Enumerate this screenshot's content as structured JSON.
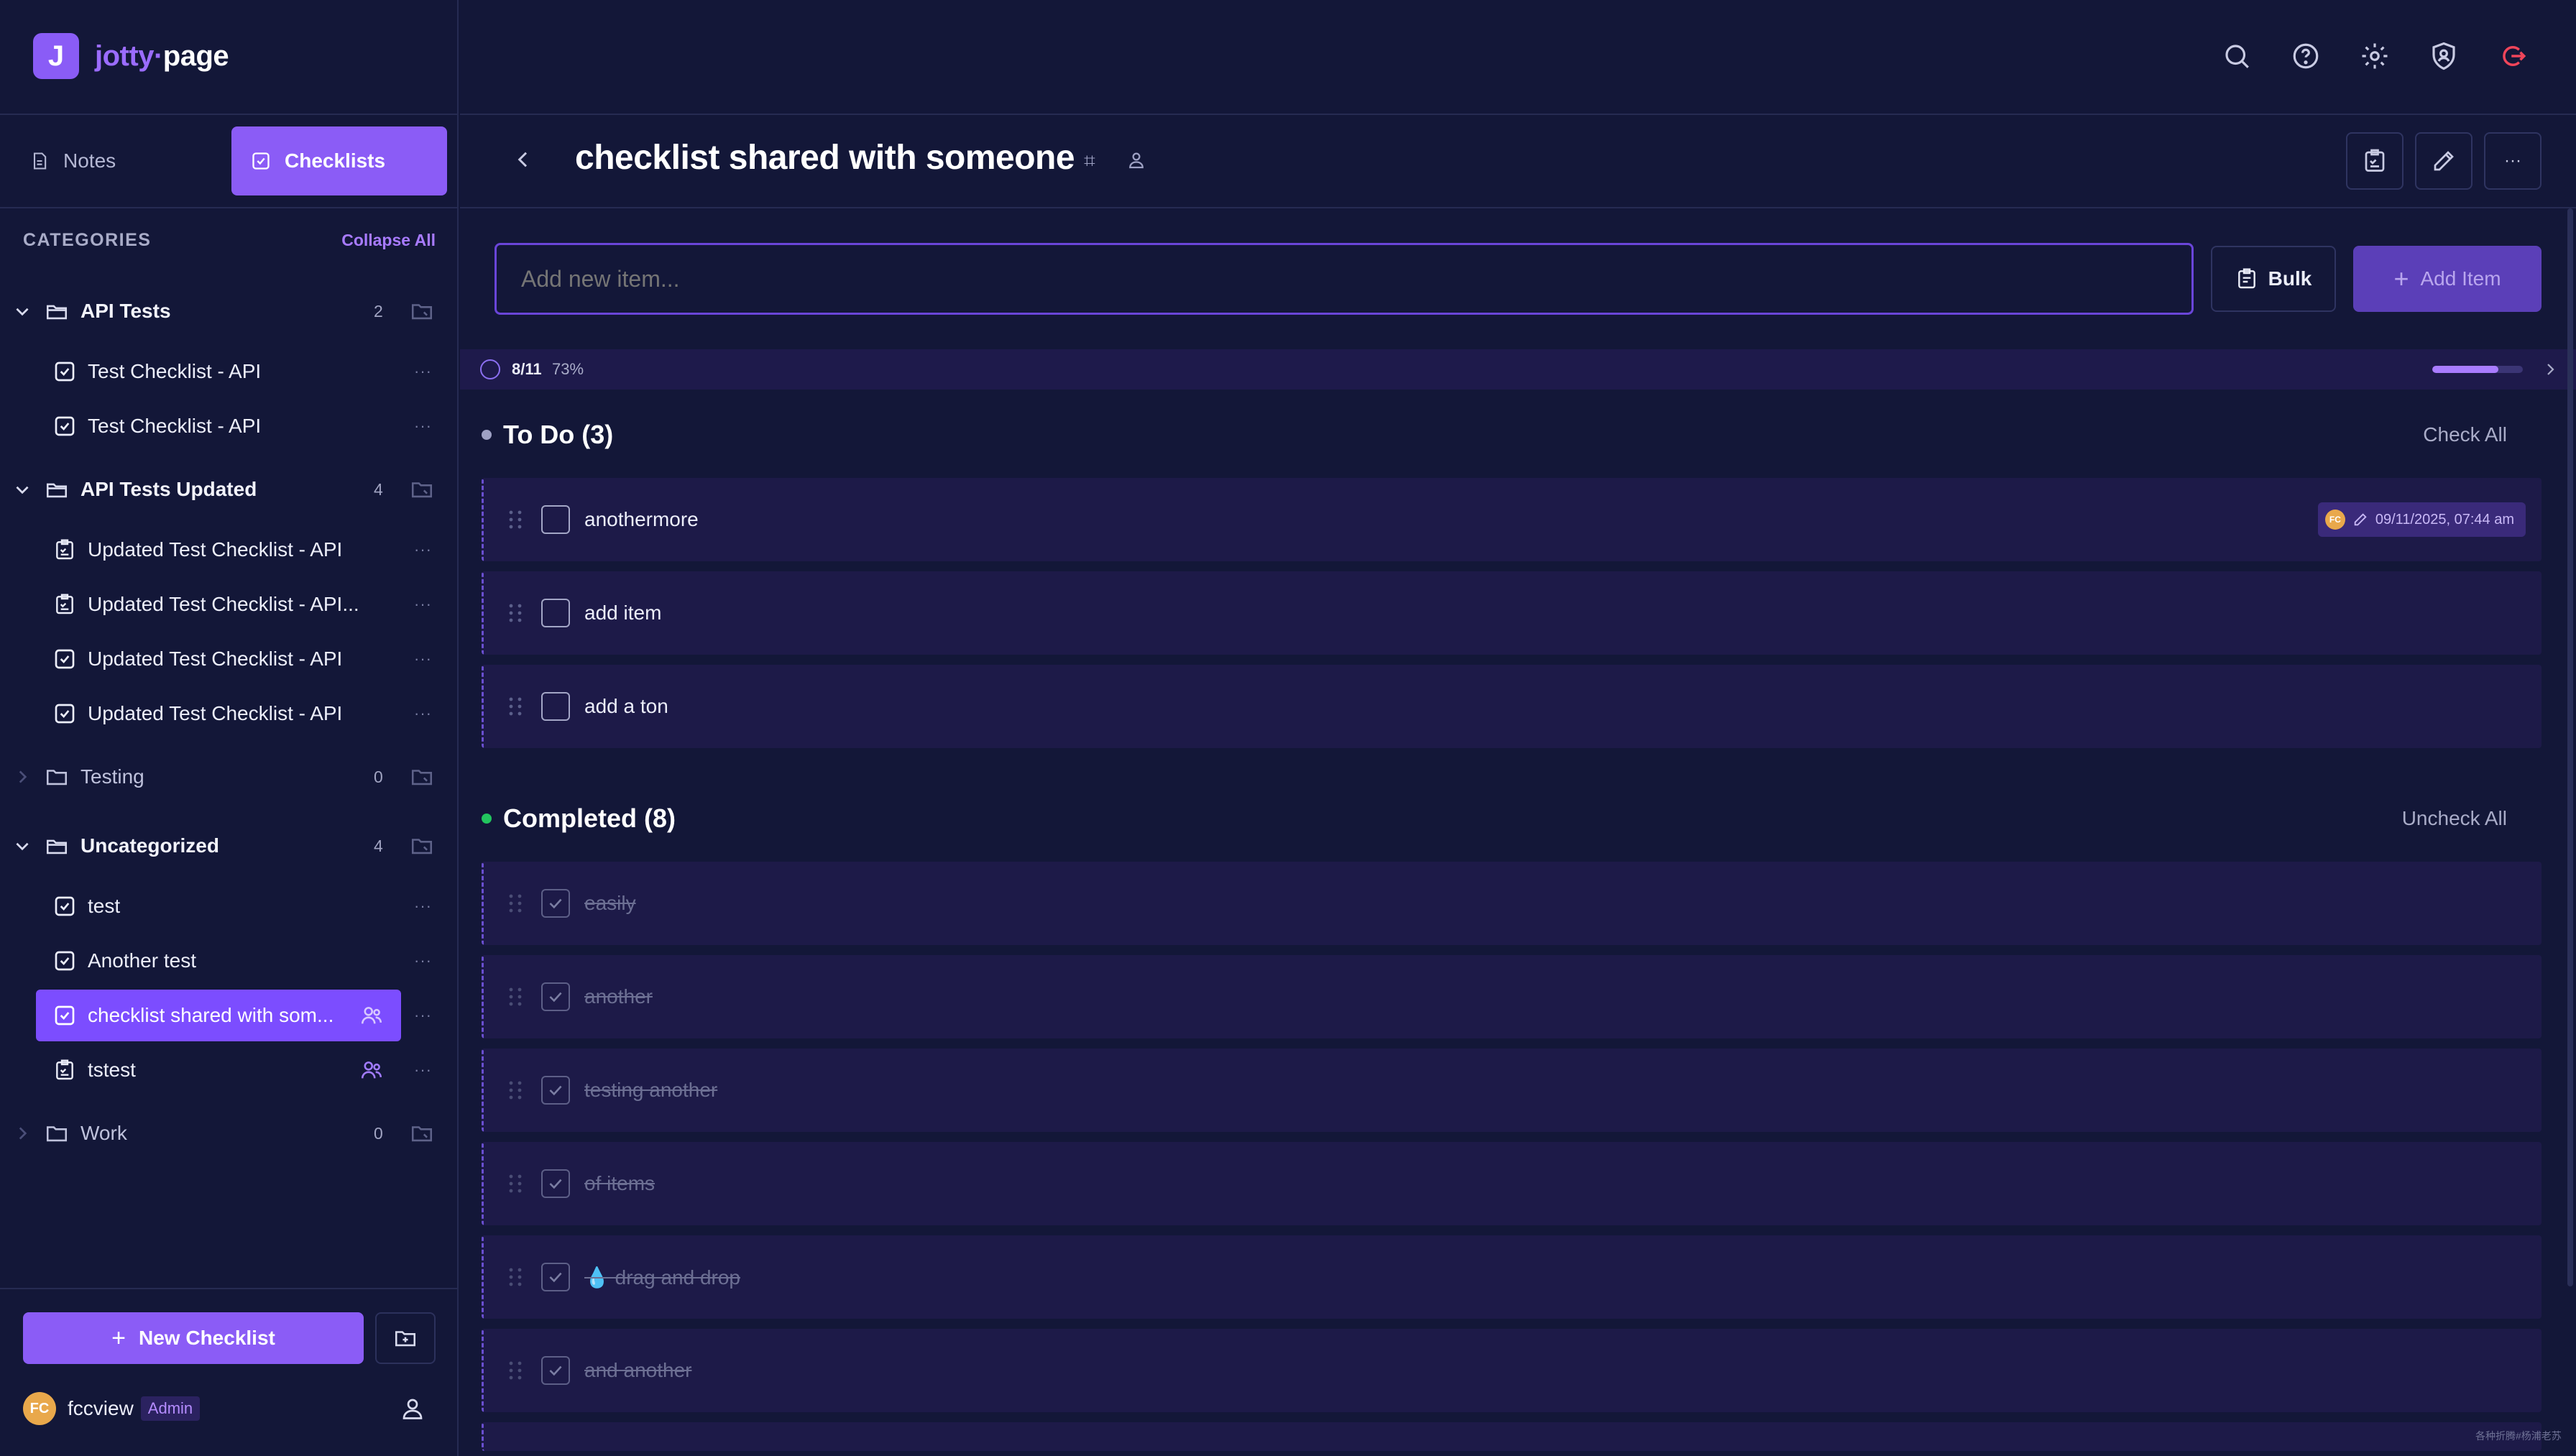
{
  "brand": {
    "name_part1": "jotty",
    "dot": "·",
    "name_part2": "page",
    "logo_letter": "J"
  },
  "tabs": {
    "notes": "Notes",
    "checklists": "Checklists"
  },
  "categories": {
    "title": "CATEGORIES",
    "collapse_all": "Collapse All"
  },
  "tree": {
    "api_tests": {
      "label": "API Tests",
      "count": "2"
    },
    "api_tests_items": [
      "Test Checklist - API",
      "Test Checklist - API"
    ],
    "api_tests_updated": {
      "label": "API Tests Updated",
      "count": "4"
    },
    "api_tests_updated_items": [
      "Updated Test Checklist - API",
      "Updated Test Checklist - API...",
      "Updated Test Checklist - API",
      "Updated Test Checklist - API"
    ],
    "testing": {
      "label": "Testing",
      "count": "0"
    },
    "uncategorized": {
      "label": "Uncategorized",
      "count": "4"
    },
    "uncategorized_items": [
      "test",
      "Another test",
      "checklist shared with som...",
      "tstest"
    ],
    "work": {
      "label": "Work",
      "count": "0"
    },
    "more": "···"
  },
  "sidebar_footer": {
    "new_checklist": "New Checklist",
    "user_initials": "FC",
    "username": "fccview",
    "role": "Admin"
  },
  "header": {
    "title": "checklist shared with someone",
    "hash": "⌗",
    "more": "···"
  },
  "add": {
    "placeholder": "Add new item...",
    "bulk": "Bulk",
    "add_item": "Add Item"
  },
  "progress": {
    "count": "8/11",
    "percent": "73%",
    "fraction": 0.73
  },
  "todo": {
    "title": "To Do (3)",
    "action": "Check All",
    "items": [
      "anothermore",
      "add item",
      "add a ton"
    ],
    "meta": {
      "initials": "FC",
      "timestamp": "09/11/2025, 07:44 am"
    }
  },
  "completed": {
    "title": "Completed (8)",
    "action": "Uncheck All",
    "items": [
      "easily",
      "another",
      "testing another",
      "of items",
      "💧 drag and drop",
      "and another"
    ]
  },
  "watermark": "各种折腾#杨浦老苏",
  "colors": {
    "accent": "#8b5cf6",
    "background": "#131738",
    "completed_dot": "#22c55e",
    "todo_dot": "#9ea1c4",
    "logout": "#f0455a"
  }
}
